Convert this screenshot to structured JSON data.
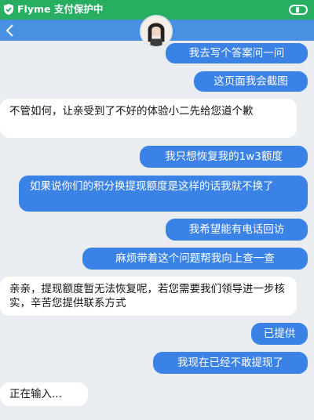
{
  "status_bar": {
    "text": "Flyme 支付保护中"
  },
  "header": {
    "back_icon": "chevron-left-icon",
    "avatar_icon": "avatar"
  },
  "colors": {
    "status_green": "#27ae60",
    "header_blue": "#4a90e2",
    "outgoing_bubble": "#3b82e6",
    "chat_bg": "#e9edf2"
  },
  "messages": [
    {
      "from": "me",
      "text": "我去写个答案问一问"
    },
    {
      "from": "me",
      "text": "这页面我会截图"
    },
    {
      "from": "agent",
      "text": "不管如何，让亲受到了不好的体验小二先给您道个歉"
    },
    {
      "from": "me",
      "text": "我只想恢复我的1w3额度"
    },
    {
      "from": "me",
      "text": "如果说你们的积分换提现额度是这样的话我就不换了"
    },
    {
      "from": "me",
      "text": "我希望能有电话回访"
    },
    {
      "from": "me",
      "text": "麻烦带着这个问题帮我向上查一查"
    },
    {
      "from": "agent",
      "text": "亲亲，提现额度暂无法恢复呢，若您需要我们领导进一步核实，辛苦您提供联系方式"
    },
    {
      "from": "me",
      "text": "已提供"
    },
    {
      "from": "me",
      "text": "我现在已经不敢提现了"
    },
    {
      "from": "agent",
      "text": "正在输入..."
    }
  ]
}
